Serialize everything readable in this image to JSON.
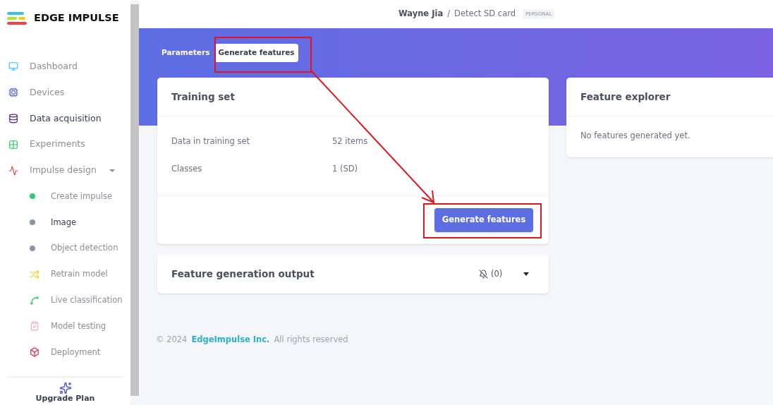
{
  "brand": {
    "name": "EDGE IMPULSE"
  },
  "sidebar": {
    "items": [
      {
        "kind": "main",
        "label": "Dashboard",
        "active": false
      },
      {
        "kind": "main",
        "label": "Devices",
        "active": false
      },
      {
        "kind": "main",
        "label": "Data acquisition",
        "active": true
      },
      {
        "kind": "main",
        "label": "Experiments",
        "active": false
      },
      {
        "kind": "main",
        "label": "Impulse design",
        "active": false,
        "expanded": true,
        "children": [
          {
            "kind": "dot",
            "color": "#2ecc71",
            "label": "Create impulse",
            "active": false
          },
          {
            "kind": "dot",
            "color": "#8a94a6",
            "label": "Image",
            "active": true
          },
          {
            "kind": "dot",
            "color": "#8a94a6",
            "label": "Object detection",
            "active": false
          }
        ]
      },
      {
        "kind": "sub",
        "label": "Retrain model",
        "active": false
      },
      {
        "kind": "sub",
        "label": "Live classification",
        "active": false
      },
      {
        "kind": "sub",
        "label": "Model testing",
        "active": false
      },
      {
        "kind": "sub",
        "label": "Deployment",
        "active": false
      }
    ],
    "upgrade": "Upgrade Plan"
  },
  "header": {
    "user": "Wayne Jia",
    "separator": "/",
    "project": "Detect SD card",
    "badge": "PERSONAL"
  },
  "tabs": [
    {
      "label": "Parameters",
      "selected": false
    },
    {
      "label": "Generate features",
      "selected": true
    }
  ],
  "training_set": {
    "title": "Training set",
    "rows": [
      {
        "label": "Data in training set",
        "value": "52 items"
      },
      {
        "label": "Classes",
        "value": "1 (SD)"
      }
    ],
    "button": "Generate features"
  },
  "output": {
    "title": "Feature generation output",
    "count": "(0)",
    "expanded": false
  },
  "explorer": {
    "title": "Feature explorer",
    "message": "No features generated yet."
  },
  "footer": {
    "prefix": "© 2024",
    "link": "EdgeImpulse Inc.",
    "suffix": "All rights reserved"
  }
}
